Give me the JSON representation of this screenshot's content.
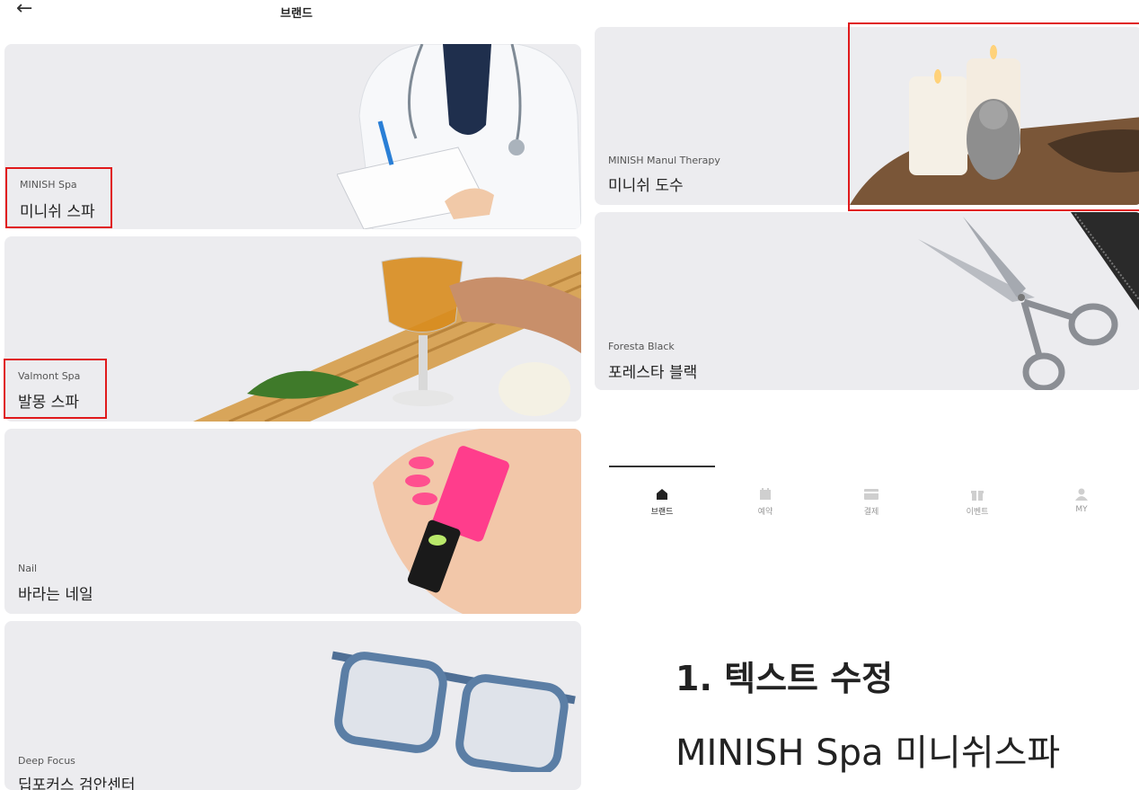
{
  "header": {
    "back_icon": "←",
    "title": "브랜드"
  },
  "brands": [
    {
      "en": "MINISH Spa",
      "ko": "미니쉬 스파",
      "image": "doctor-with-clipboard"
    },
    {
      "en": "Valmont Spa",
      "ko": "발몽 스파",
      "image": "glass-of-tea-on-bamboo-tray"
    },
    {
      "en": "Nail",
      "ko": "바라는 네일",
      "image": "hand-with-pink-nail-polish"
    },
    {
      "en": "Deep Focus",
      "ko": "딥포커스 검안센터",
      "image": "blue-glasses"
    },
    {
      "en": "MINISH Manul Therapy",
      "ko": "미니쉬 도수",
      "image": "candles-and-ganesha-statue"
    },
    {
      "en": "Foresta Black",
      "ko": "포레스타 블랙",
      "image": "scissors-and-comb"
    }
  ],
  "bottom_nav": [
    {
      "label": "브랜드",
      "icon": "home-icon",
      "active": true
    },
    {
      "label": "예약",
      "icon": "calendar-icon",
      "active": false
    },
    {
      "label": "결제",
      "icon": "card-icon",
      "active": false
    },
    {
      "label": "이벤트",
      "icon": "gift-icon",
      "active": false
    },
    {
      "label": "MY",
      "icon": "user-icon",
      "active": false
    }
  ],
  "annotation": {
    "heading": "1.  텍스트 수정",
    "text": "MINISH Spa 미니쉬스파"
  },
  "colors": {
    "highlight": "#e0191b",
    "card_bg": "#ececef"
  }
}
